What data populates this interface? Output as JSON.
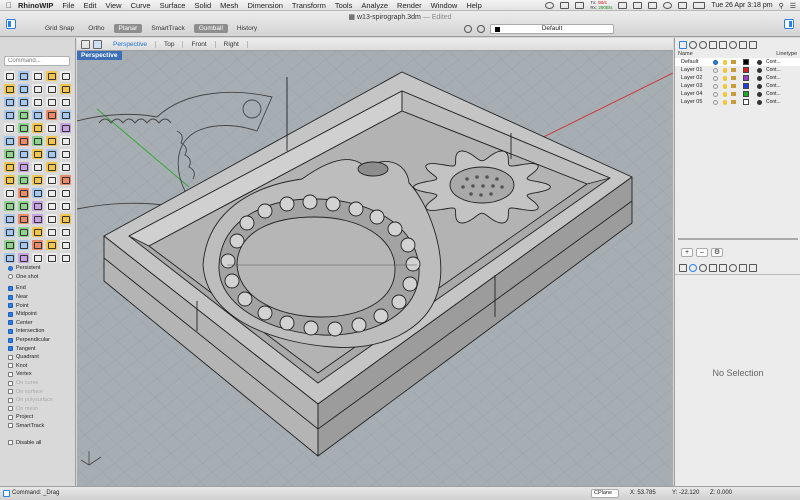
{
  "menubar": {
    "app_name": "RhinoWIP",
    "menus": [
      "File",
      "Edit",
      "View",
      "Curve",
      "Surface",
      "Solid",
      "Mesh",
      "Dimension",
      "Transform",
      "Tools",
      "Analyze",
      "Render",
      "Window",
      "Help"
    ],
    "net_tx": "Tx:",
    "net_rx": "Rx:",
    "net_speed": "0B/s",
    "net_speed2": "290B/s",
    "clock": "Tue 26 Apr  3:18 pm"
  },
  "toolbar": {
    "document_title": "w13-spirograph.3dm",
    "edited_label": "— Edited",
    "modes": [
      {
        "label": "Grid Snap",
        "on": false
      },
      {
        "label": "Ortho",
        "on": false
      },
      {
        "label": "Planar",
        "on": true
      },
      {
        "label": "SmartTrack",
        "on": false
      },
      {
        "label": "Gumball",
        "on": true
      },
      {
        "label": "History",
        "on": false
      }
    ],
    "current_layer": "Default"
  },
  "command": {
    "placeholder": "Command..."
  },
  "osnap": {
    "persistent_label": "Persistent",
    "one_shot_label": "One shot",
    "items": [
      {
        "label": "End",
        "checked": true,
        "enabled": true
      },
      {
        "label": "Near",
        "checked": true,
        "enabled": true
      },
      {
        "label": "Point",
        "checked": true,
        "enabled": true
      },
      {
        "label": "Midpoint",
        "checked": true,
        "enabled": true
      },
      {
        "label": "Center",
        "checked": true,
        "enabled": true
      },
      {
        "label": "Intersection",
        "checked": true,
        "enabled": true
      },
      {
        "label": "Perpendicular",
        "checked": true,
        "enabled": true
      },
      {
        "label": "Tangent",
        "checked": true,
        "enabled": true
      },
      {
        "label": "Quadrant",
        "checked": false,
        "enabled": true
      },
      {
        "label": "Knot",
        "checked": false,
        "enabled": true
      },
      {
        "label": "Vertex",
        "checked": false,
        "enabled": true
      },
      {
        "label": "On curve",
        "checked": false,
        "enabled": false
      },
      {
        "label": "On surface",
        "checked": false,
        "enabled": false
      },
      {
        "label": "On polysurface",
        "checked": false,
        "enabled": false
      },
      {
        "label": "On mesh",
        "checked": false,
        "enabled": false
      },
      {
        "label": "Project",
        "checked": false,
        "enabled": true
      },
      {
        "label": "SmartTrack",
        "checked": false,
        "enabled": true
      }
    ],
    "disable_all_label": "Disable all"
  },
  "viewport": {
    "tabs": [
      "Perspective",
      "Top",
      "Front",
      "Right"
    ],
    "active_tab": "Perspective",
    "label": "Perspective",
    "background_color": "#a7aeb3",
    "grid_color": "#9aa1a6",
    "object_color": "#b3b3b3"
  },
  "layers": {
    "name_header": "Name",
    "linetype_header": "Linetype",
    "rows": [
      {
        "name": "Default",
        "color": "#000000",
        "linetype": "Cont..."
      },
      {
        "name": "Layer 01",
        "color": "#d81e1e",
        "linetype": "Cont..."
      },
      {
        "name": "Layer 02",
        "color": "#9b3fc9",
        "linetype": "Cont..."
      },
      {
        "name": "Layer 03",
        "color": "#1e3fd8",
        "linetype": "Cont..."
      },
      {
        "name": "Layer 04",
        "color": "#1eaa2a",
        "linetype": "Cont..."
      },
      {
        "name": "Layer 05",
        "color": "#ffffff",
        "linetype": "Cont..."
      }
    ]
  },
  "properties": {
    "empty_label": "No Selection"
  },
  "status": {
    "command_text": "Command: _Drag",
    "cplane_label": "CPlane",
    "x_label": "X: 53.785",
    "y_label": "Y: -22.120",
    "z_label": "Z: 0.000"
  }
}
